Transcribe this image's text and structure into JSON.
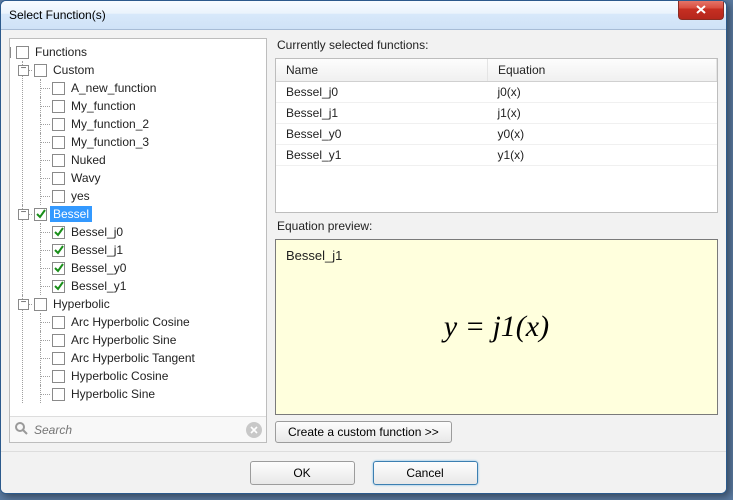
{
  "window": {
    "title": "Select Function(s)"
  },
  "tree": {
    "root_label": "Functions",
    "groups": [
      {
        "label": "Custom",
        "checked": false,
        "expanded": true,
        "items": [
          {
            "label": "A_new_function",
            "checked": false
          },
          {
            "label": "My_function",
            "checked": false
          },
          {
            "label": "My_function_2",
            "checked": false
          },
          {
            "label": "My_function_3",
            "checked": false
          },
          {
            "label": "Nuked",
            "checked": false
          },
          {
            "label": "Wavy",
            "checked": false
          },
          {
            "label": "yes",
            "checked": false
          }
        ]
      },
      {
        "label": "Bessel",
        "checked": true,
        "expanded": true,
        "selected": true,
        "items": [
          {
            "label": "Bessel_j0",
            "checked": true
          },
          {
            "label": "Bessel_j1",
            "checked": true
          },
          {
            "label": "Bessel_y0",
            "checked": true
          },
          {
            "label": "Bessel_y1",
            "checked": true
          }
        ]
      },
      {
        "label": "Hyperbolic",
        "checked": false,
        "expanded": true,
        "items": [
          {
            "label": "Arc Hyperbolic Cosine",
            "checked": false
          },
          {
            "label": "Arc Hyperbolic Sine",
            "checked": false
          },
          {
            "label": "Arc Hyperbolic Tangent",
            "checked": false
          },
          {
            "label": "Hyperbolic Cosine",
            "checked": false
          },
          {
            "label": "Hyperbolic Sine",
            "checked": false
          }
        ]
      }
    ]
  },
  "search": {
    "placeholder": "Search"
  },
  "selected_table": {
    "title": "Currently selected functions:",
    "columns": [
      "Name",
      "Equation"
    ],
    "rows": [
      {
        "name": "Bessel_j0",
        "equation": "j0(x)"
      },
      {
        "name": "Bessel_j1",
        "equation": "j1(x)"
      },
      {
        "name": "Bessel_y0",
        "equation": "y0(x)"
      },
      {
        "name": "Bessel_y1",
        "equation": "y1(x)"
      }
    ]
  },
  "preview": {
    "title": "Equation preview:",
    "name": "Bessel_j1",
    "equation_html": "y = j1(x)"
  },
  "buttons": {
    "create_custom": "Create a custom function >>",
    "ok": "OK",
    "cancel": "Cancel"
  }
}
